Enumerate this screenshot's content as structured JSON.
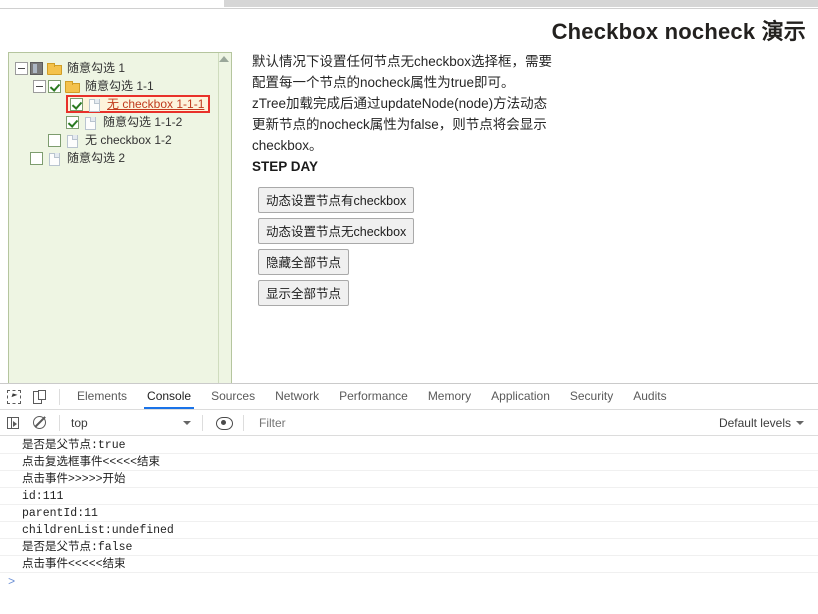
{
  "page": {
    "title": "Checkbox nocheck 演示",
    "description_lines": [
      "默认情况下设置任何节点无checkbox选择框，需要",
      "配置每一个节点的nocheck属性为true即可。",
      "zTree加载完成后通过updateNode(node)方法动态",
      "更新节点的nocheck属性为false，则节点将会显示",
      "checkbox。"
    ],
    "step_label": "STEP DAY"
  },
  "tree": {
    "nodes": [
      {
        "label": "随意勾选 1",
        "level": 0,
        "switch": "minus",
        "checkbox": "partial",
        "icon": "folder-icon",
        "selected": false
      },
      {
        "label": "随意勾选 1-1",
        "level": 1,
        "switch": "minus",
        "checkbox": "checked",
        "icon": "folder-icon",
        "selected": false
      },
      {
        "label": "无 checkbox 1-1-1",
        "level": 2,
        "switch": "none",
        "checkbox": "checked",
        "icon": "file-icon",
        "selected": true
      },
      {
        "label": "随意勾选 1-1-2",
        "level": 2,
        "switch": "none",
        "checkbox": "checked",
        "icon": "file-icon",
        "selected": false
      },
      {
        "label": "无 checkbox 1-2",
        "level": 1,
        "switch": "none",
        "checkbox": "unchecked",
        "icon": "file-icon",
        "selected": false
      },
      {
        "label": "随意勾选 2",
        "level": 0,
        "switch": "none",
        "checkbox": "unchecked",
        "icon": "file-icon",
        "selected": false
      }
    ]
  },
  "buttons": [
    {
      "label": "动态设置节点有checkbox"
    },
    {
      "label": "动态设置节点无checkbox"
    },
    {
      "label": "隐藏全部节点"
    },
    {
      "label": "显示全部节点"
    }
  ],
  "devtools": {
    "tabs": [
      {
        "label": "Elements",
        "active": false
      },
      {
        "label": "Console",
        "active": true
      },
      {
        "label": "Sources",
        "active": false
      },
      {
        "label": "Network",
        "active": false
      },
      {
        "label": "Performance",
        "active": false
      },
      {
        "label": "Memory",
        "active": false
      },
      {
        "label": "Application",
        "active": false
      },
      {
        "label": "Security",
        "active": false
      },
      {
        "label": "Audits",
        "active": false
      }
    ],
    "filterbar": {
      "context": "top",
      "filter_placeholder": "Filter",
      "levels": "Default levels"
    },
    "console_messages": [
      "是否是父节点:true",
      "点击复选框事件<<<<<结束",
      "点击事件>>>>>开始",
      "id:111",
      "parentId:11",
      "childrenList:undefined",
      "是否是父节点:false",
      "点击事件<<<<<结束"
    ],
    "prompt": ">"
  },
  "colors": {
    "tree_bg": "#eef5e3",
    "tree_border": "#b5c59e",
    "selected_border": "#e8312a",
    "selected_bg": "#fdf4db",
    "selected_text": "#c03c1e",
    "active_tab_underline": "#1a73e8"
  }
}
